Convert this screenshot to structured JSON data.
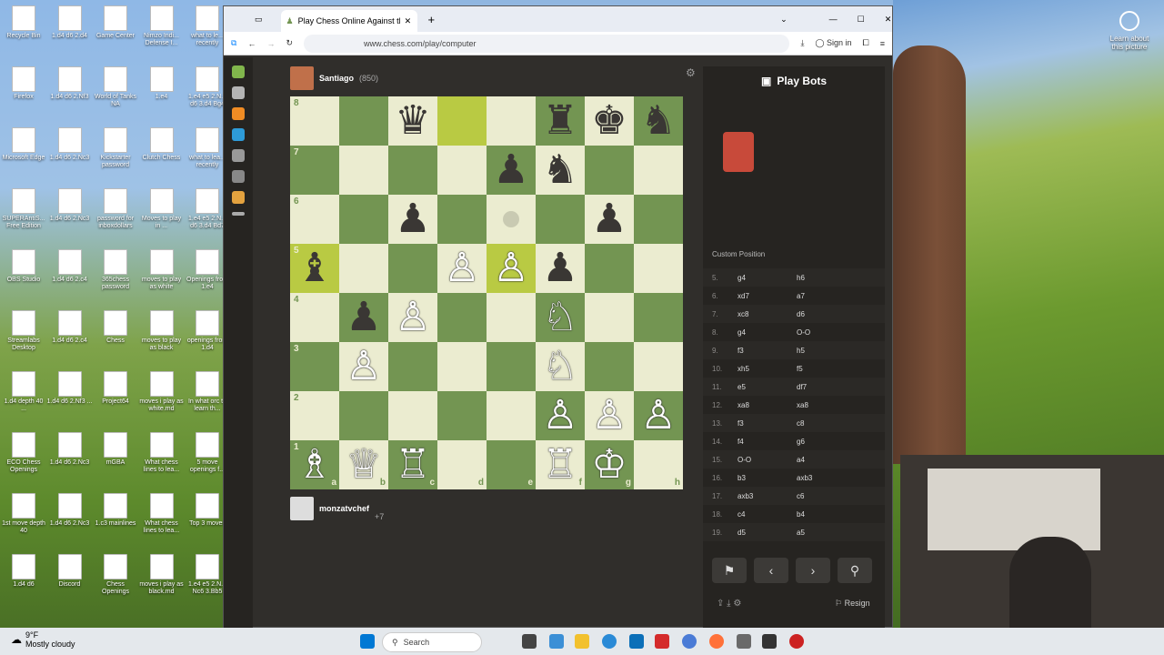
{
  "desktop": {
    "icons": [
      {
        "label": "Recycle Bin",
        "col": 0,
        "row": 0
      },
      {
        "label": "1.d4 d6 2.d4",
        "col": 1,
        "row": 0
      },
      {
        "label": "Game Center",
        "col": 2,
        "row": 0
      },
      {
        "label": "Nimzo Indi... Defense I...",
        "col": 3,
        "row": 0
      },
      {
        "label": "what to le... recently",
        "col": 4,
        "row": 0
      },
      {
        "label": "Firefox",
        "col": 0,
        "row": 1
      },
      {
        "label": "1.d4 d6 2.Nf3",
        "col": 1,
        "row": 1
      },
      {
        "label": "World of Tanks NA",
        "col": 2,
        "row": 1
      },
      {
        "label": "1.e4",
        "col": 3,
        "row": 1
      },
      {
        "label": "1.e4 e5 2.N... d6 3.d4 Bg4",
        "col": 4,
        "row": 1
      },
      {
        "label": "Microsoft Edge",
        "col": 0,
        "row": 2
      },
      {
        "label": "1.d4 d6 2.Nc3",
        "col": 1,
        "row": 2
      },
      {
        "label": "Kickstarter password",
        "col": 2,
        "row": 2
      },
      {
        "label": "Clutch Chess",
        "col": 3,
        "row": 2
      },
      {
        "label": "what to lea... recently",
        "col": 4,
        "row": 2
      },
      {
        "label": "SUPERAntiS... Free Edition",
        "col": 0,
        "row": 3
      },
      {
        "label": "1.d4 d6 2.Nc3",
        "col": 1,
        "row": 3
      },
      {
        "label": "password for inboxdollars",
        "col": 2,
        "row": 3
      },
      {
        "label": "Moves to play in ...",
        "col": 3,
        "row": 3
      },
      {
        "label": "1.e4 e5 2.N... d6 3.d4 Bd7",
        "col": 4,
        "row": 3
      },
      {
        "label": "OBS Studio",
        "col": 0,
        "row": 4
      },
      {
        "label": "1.d4 d6 2.c4",
        "col": 1,
        "row": 4
      },
      {
        "label": "365chess password",
        "col": 2,
        "row": 4
      },
      {
        "label": "moves to play as white",
        "col": 3,
        "row": 4
      },
      {
        "label": "Openings from 1.e4",
        "col": 4,
        "row": 4
      },
      {
        "label": "Streamlabs Desktop",
        "col": 0,
        "row": 5
      },
      {
        "label": "1.d4 d6 2.c4",
        "col": 1,
        "row": 5
      },
      {
        "label": "Chess",
        "col": 2,
        "row": 5
      },
      {
        "label": "moves to play as black",
        "col": 3,
        "row": 5
      },
      {
        "label": "openings from 1.d4",
        "col": 4,
        "row": 5
      },
      {
        "label": "1.d4 depth 40 ...",
        "col": 0,
        "row": 6
      },
      {
        "label": "1.d4 d6 2.Nf3 ...",
        "col": 1,
        "row": 6
      },
      {
        "label": "Project64",
        "col": 2,
        "row": 6
      },
      {
        "label": "moves i play as white.md",
        "col": 3,
        "row": 6
      },
      {
        "label": "In what orc to learn th...",
        "col": 4,
        "row": 6
      },
      {
        "label": "ECO Chess Openings",
        "col": 0,
        "row": 7
      },
      {
        "label": "1.d4 d6 2.Nc3",
        "col": 1,
        "row": 7
      },
      {
        "label": "mGBA",
        "col": 2,
        "row": 7
      },
      {
        "label": "What chess lines to lea...",
        "col": 3,
        "row": 7
      },
      {
        "label": "5 move openings f...",
        "col": 4,
        "row": 7
      },
      {
        "label": "1st move depth 40",
        "col": 0,
        "row": 8
      },
      {
        "label": "1.d4 d6 2.Nc3",
        "col": 1,
        "row": 8
      },
      {
        "label": "1.c3 mainlines",
        "col": 2,
        "row": 8
      },
      {
        "label": "What chess lines to lea...",
        "col": 3,
        "row": 8
      },
      {
        "label": "Top 3 moves",
        "col": 4,
        "row": 8
      },
      {
        "label": "1.d4 d6",
        "col": 0,
        "row": 9
      },
      {
        "label": "Discord",
        "col": 1,
        "row": 9
      },
      {
        "label": "Chess Openings",
        "col": 2,
        "row": 9
      },
      {
        "label": "moves i play as black.md",
        "col": 3,
        "row": 9
      },
      {
        "label": "1.e4 e5 2.N... Nc6 3.Bb5",
        "col": 4,
        "row": 9
      }
    ],
    "right_label": "Learn about this picture"
  },
  "browser": {
    "tab_title": "Play Chess Online Against the C",
    "url": "www.chess.com/play/computer",
    "signin": "Sign in"
  },
  "game": {
    "opponent_name": "Santiago",
    "opponent_rating": "(850)",
    "player_name": "monzatvchef",
    "player_extra": "+7",
    "ranks": [
      "8",
      "7",
      "6",
      "5",
      "4",
      "3",
      "2",
      "1"
    ],
    "files": [
      "a",
      "b",
      "c",
      "d",
      "e",
      "f",
      "g",
      "h"
    ],
    "board": [
      [
        "",
        "",
        "bQ",
        "",
        "",
        "bR",
        "bK",
        "bN"
      ],
      [
        "",
        "",
        "",
        "",
        "bP",
        "bN",
        "",
        ""
      ],
      [
        "",
        "",
        "bP",
        "",
        "",
        "",
        "bP",
        ""
      ],
      [
        "bB",
        "",
        "",
        "wP",
        "wP",
        "bP",
        "",
        ""
      ],
      [
        "",
        "bP",
        "wP",
        "",
        "",
        "wN",
        "",
        ""
      ],
      [
        "",
        "wP",
        "",
        "",
        "",
        "wN",
        "",
        ""
      ],
      [
        "",
        "",
        "",
        "",
        "",
        "wP",
        "wP",
        "wP"
      ],
      [
        "wB",
        "wQ",
        "wR",
        "",
        "",
        "wR",
        "wK",
        ""
      ]
    ],
    "highlights": [
      "d8",
      "a5",
      "e5"
    ],
    "hint_square": "e6"
  },
  "panel": {
    "title": "Play Bots",
    "custom_position": "Custom Position",
    "moves": [
      [
        "5.",
        "g4",
        "h6"
      ],
      [
        "6.",
        "xd7",
        "a7"
      ],
      [
        "7.",
        "xc8",
        "d6"
      ],
      [
        "8.",
        "g4",
        "O-O"
      ],
      [
        "9.",
        "f3",
        "h5"
      ],
      [
        "10.",
        "xh5",
        "f5"
      ],
      [
        "11.",
        "e5",
        "df7"
      ],
      [
        "12.",
        "xa8",
        "xa8"
      ],
      [
        "13.",
        "f3",
        "c8"
      ],
      [
        "14.",
        "f4",
        "g6"
      ],
      [
        "15.",
        "O-O",
        "a4"
      ],
      [
        "16.",
        "b3",
        "axb3"
      ],
      [
        "17.",
        "axb3",
        "c6"
      ],
      [
        "18.",
        "c4",
        "b4"
      ],
      [
        "19.",
        "d5",
        "a5"
      ]
    ],
    "resign": "Resign"
  },
  "taskbar": {
    "weather_temp": "9°F",
    "weather_desc": "Mostly cloudy",
    "search": "Search"
  }
}
